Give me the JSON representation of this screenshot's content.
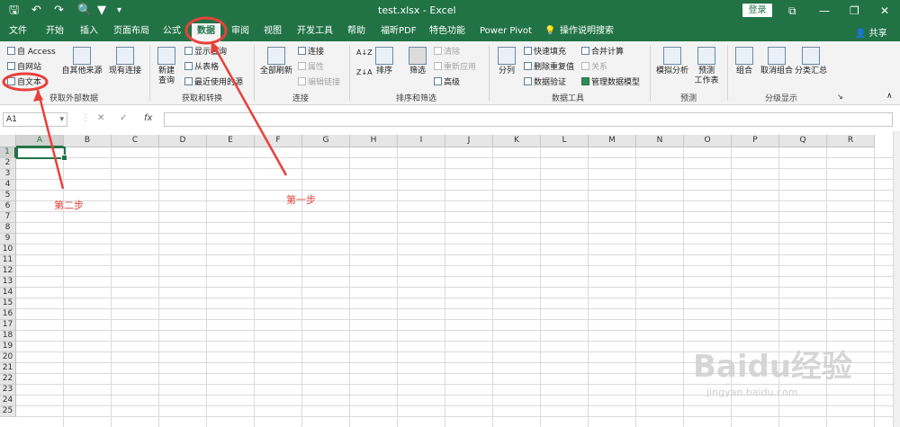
{
  "titlebar": {
    "title": "test.xlsx  -  Excel",
    "login": "登录",
    "restore_glyph": "⧉",
    "minimize_glyph": "—",
    "maximize_glyph": "❐",
    "close_glyph": "✕",
    "qa_save": "🖫",
    "qa_undo": "↶",
    "qa_redo": "↷",
    "qa_preview": "🔍",
    "qa_filter": "▼",
    "qa_more": "▾"
  },
  "tabs": {
    "file": "文件",
    "home": "开始",
    "insert": "插入",
    "layout": "页面布局",
    "formula": "公式",
    "data": "数据",
    "review": "审阅",
    "view": "视图",
    "developer": "开发工具",
    "help": "帮助",
    "pdf": "福昕PDF",
    "special": "特色功能",
    "powerpivot": "Power Pivot",
    "tellme": "操作说明搜索",
    "share": "共享"
  },
  "ribbon": {
    "get_external": {
      "access": "自 Access",
      "web": "自网站",
      "text": "自文本",
      "other": "自其他来源",
      "existing": "现有连接",
      "label": "获取外部数据"
    },
    "get_transform": {
      "new_query": "新建\n查询",
      "show_query": "显示查询",
      "from_table": "从表格",
      "recent": "最近使用的源",
      "label": "获取和转换"
    },
    "connections": {
      "refresh_all": "全部刷新",
      "connections": "连接",
      "properties": "属性",
      "edit_links": "编辑链接",
      "label": "连接"
    },
    "sort_filter": {
      "sort": "排序",
      "filter": "筛选",
      "clear": "清除",
      "reapply": "重新应用",
      "advanced": "高级",
      "label": "排序和筛选"
    },
    "data_tools": {
      "split": "分列",
      "flash_fill": "快速填充",
      "remove_dup": "删除重复值",
      "validation": "数据验证",
      "consolidate": "合并计算",
      "relations": "关系",
      "manage_model": "管理数据模型",
      "label": "数据工具"
    },
    "forecast": {
      "whatif": "模拟分析",
      "forecast_sheet": "预测\n工作表",
      "label": "预测"
    },
    "outline": {
      "group": "组合",
      "ungroup": "取消组合",
      "subtotal": "分类汇总",
      "label": "分级显示"
    }
  },
  "formula_bar": {
    "name_box": "A1",
    "cancel": "✕",
    "enter": "✓",
    "fx": "fx",
    "value": ""
  },
  "grid": {
    "columns": [
      "A",
      "B",
      "C",
      "D",
      "E",
      "F",
      "G",
      "H",
      "I",
      "J",
      "K",
      "L",
      "M",
      "N",
      "O",
      "P",
      "Q",
      "R"
    ],
    "rows": [
      "1",
      "2",
      "3",
      "4",
      "5",
      "6",
      "7",
      "8",
      "9",
      "10",
      "11",
      "12",
      "13",
      "14",
      "15",
      "16",
      "17",
      "18",
      "19",
      "20",
      "21",
      "22",
      "23",
      "24",
      "25"
    ],
    "selected_cell": "A1"
  },
  "annotations": {
    "step1": "第一步",
    "step2": "第二步"
  },
  "watermark": {
    "brand": "Baidu经验",
    "url": "jingyan.baidu.com"
  },
  "colors": {
    "excel_green": "#217346",
    "annotation_red": "#e8413a"
  }
}
